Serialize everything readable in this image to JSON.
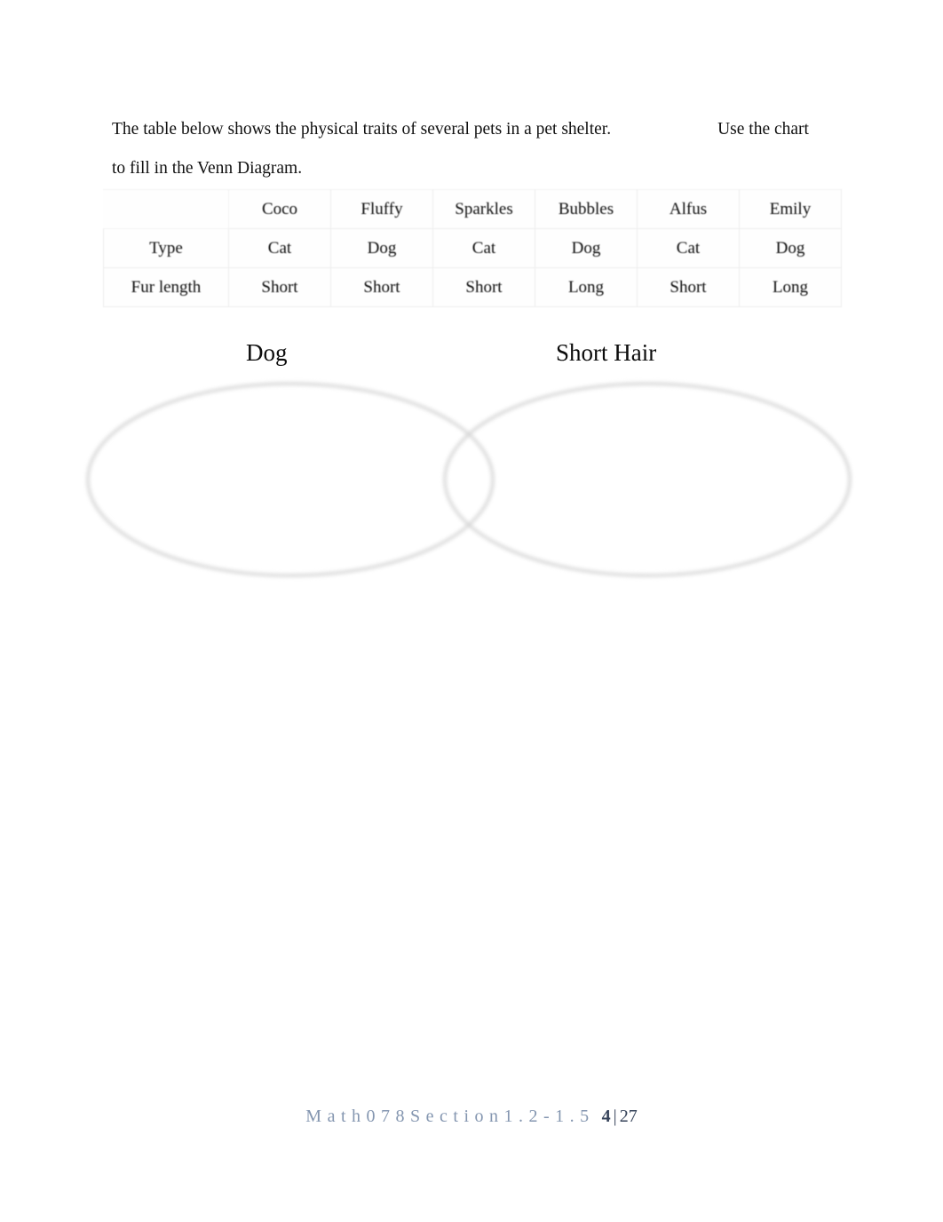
{
  "document": {
    "intro_sentence_1": "The table below shows the physical traits of several pets in a pet shelter.",
    "intro_sentence_2": "Use the chart to fill in the Venn Diagram."
  },
  "table": {
    "corner_label": "",
    "columns": [
      "Coco",
      "Fluffy",
      "Sparkles",
      "Bubbles",
      "Alfus",
      "Emily"
    ],
    "rows": [
      {
        "header": "Type",
        "cells": [
          "Cat",
          "Dog",
          "Cat",
          "Dog",
          "Cat",
          "Dog"
        ]
      },
      {
        "header": "Fur length",
        "cells": [
          "Short",
          "Short",
          "Short",
          "Long",
          "Short",
          "Long"
        ]
      }
    ]
  },
  "venn": {
    "left_label": "Dog",
    "right_label": "Short Hair",
    "stroke_color": "#d5d5d5"
  },
  "footer": {
    "doc_id": "Math078Section1.2-1.5",
    "page_number": "4",
    "page_separator": "|",
    "page_total": "27",
    "doc_id_color": "#8496b0",
    "page_color": "#36435a"
  },
  "chart_data": {
    "type": "table",
    "title": "Physical traits of pets in a pet shelter",
    "categories": [
      "Coco",
      "Fluffy",
      "Sparkles",
      "Bubbles",
      "Alfus",
      "Emily"
    ],
    "series": [
      {
        "name": "Type",
        "values": [
          "Cat",
          "Dog",
          "Cat",
          "Dog",
          "Cat",
          "Dog"
        ]
      },
      {
        "name": "Fur length",
        "values": [
          "Short",
          "Short",
          "Short",
          "Long",
          "Short",
          "Long"
        ]
      }
    ],
    "venn": {
      "set_a": "Dog",
      "set_b": "Short Hair",
      "regions": {
        "a_only": [],
        "intersection": [],
        "b_only": [],
        "outside": []
      }
    }
  }
}
